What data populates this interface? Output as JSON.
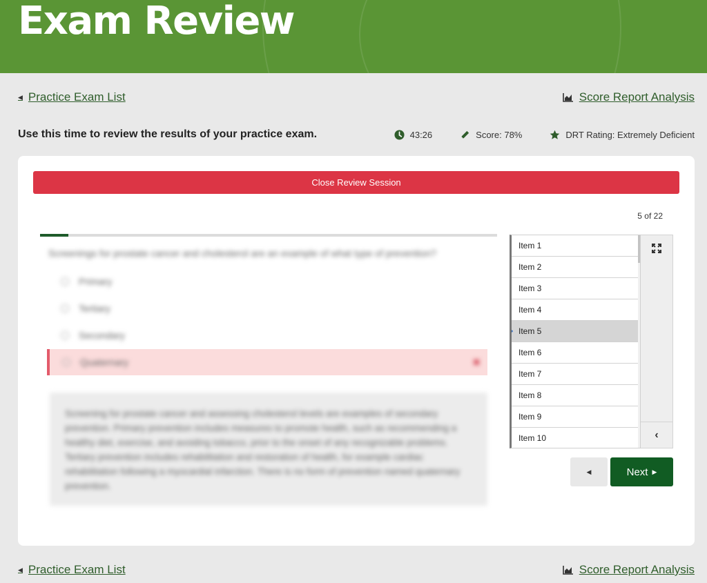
{
  "header": {
    "title": "Exam Review"
  },
  "nav": {
    "back_label": "Practice Exam List",
    "report_label": "Score Report Analysis"
  },
  "info": {
    "instruction": "Use this time to review the results of your practice exam.",
    "time": "43:26",
    "score": "Score: 78%",
    "rating": "DRT Rating: Extremely Deficient"
  },
  "review": {
    "close_label": "Close Review Session",
    "counter": "5 of 22",
    "progress_fraction": 0.0625
  },
  "question": {
    "text": "Screenings for prostate cancer and cholesterol are an example of what type of prevention?",
    "options": [
      {
        "label": "Primary"
      },
      {
        "label": "Tertiary"
      },
      {
        "label": "Secondary"
      },
      {
        "label": "Quaternary",
        "state": "incorrect"
      }
    ],
    "explanation": "Screening for prostate cancer and assessing cholesterol levels are examples of secondary prevention. Primary prevention includes measures to promote health, such as recommending a healthy diet, exercise, and avoiding tobacco, prior to the onset of any recognizable problems. Tertiary prevention includes rehabilitation and restoration of health, for example cardiac rehabilitation following a myocardial infarction. There is no form of prevention named quaternary prevention."
  },
  "items": [
    {
      "label": "Item 1"
    },
    {
      "label": "Item 2"
    },
    {
      "label": "Item 3"
    },
    {
      "label": "Item 4"
    },
    {
      "label": "Item 5",
      "active": true
    },
    {
      "label": "Item 6"
    },
    {
      "label": "Item 7"
    },
    {
      "label": "Item 8"
    },
    {
      "label": "Item 9"
    },
    {
      "label": "Item 10"
    }
  ],
  "buttons": {
    "next_label": "Next"
  },
  "icons": {
    "clock": "clock-icon",
    "pencil": "pencil-icon",
    "star": "star-icon",
    "chart": "chart-area-icon",
    "expand": "expand-icon"
  },
  "colors": {
    "brand_green": "#5a9535",
    "danger": "#dc3545",
    "next_green": "#115c23",
    "link_green": "#2f5d2b"
  }
}
